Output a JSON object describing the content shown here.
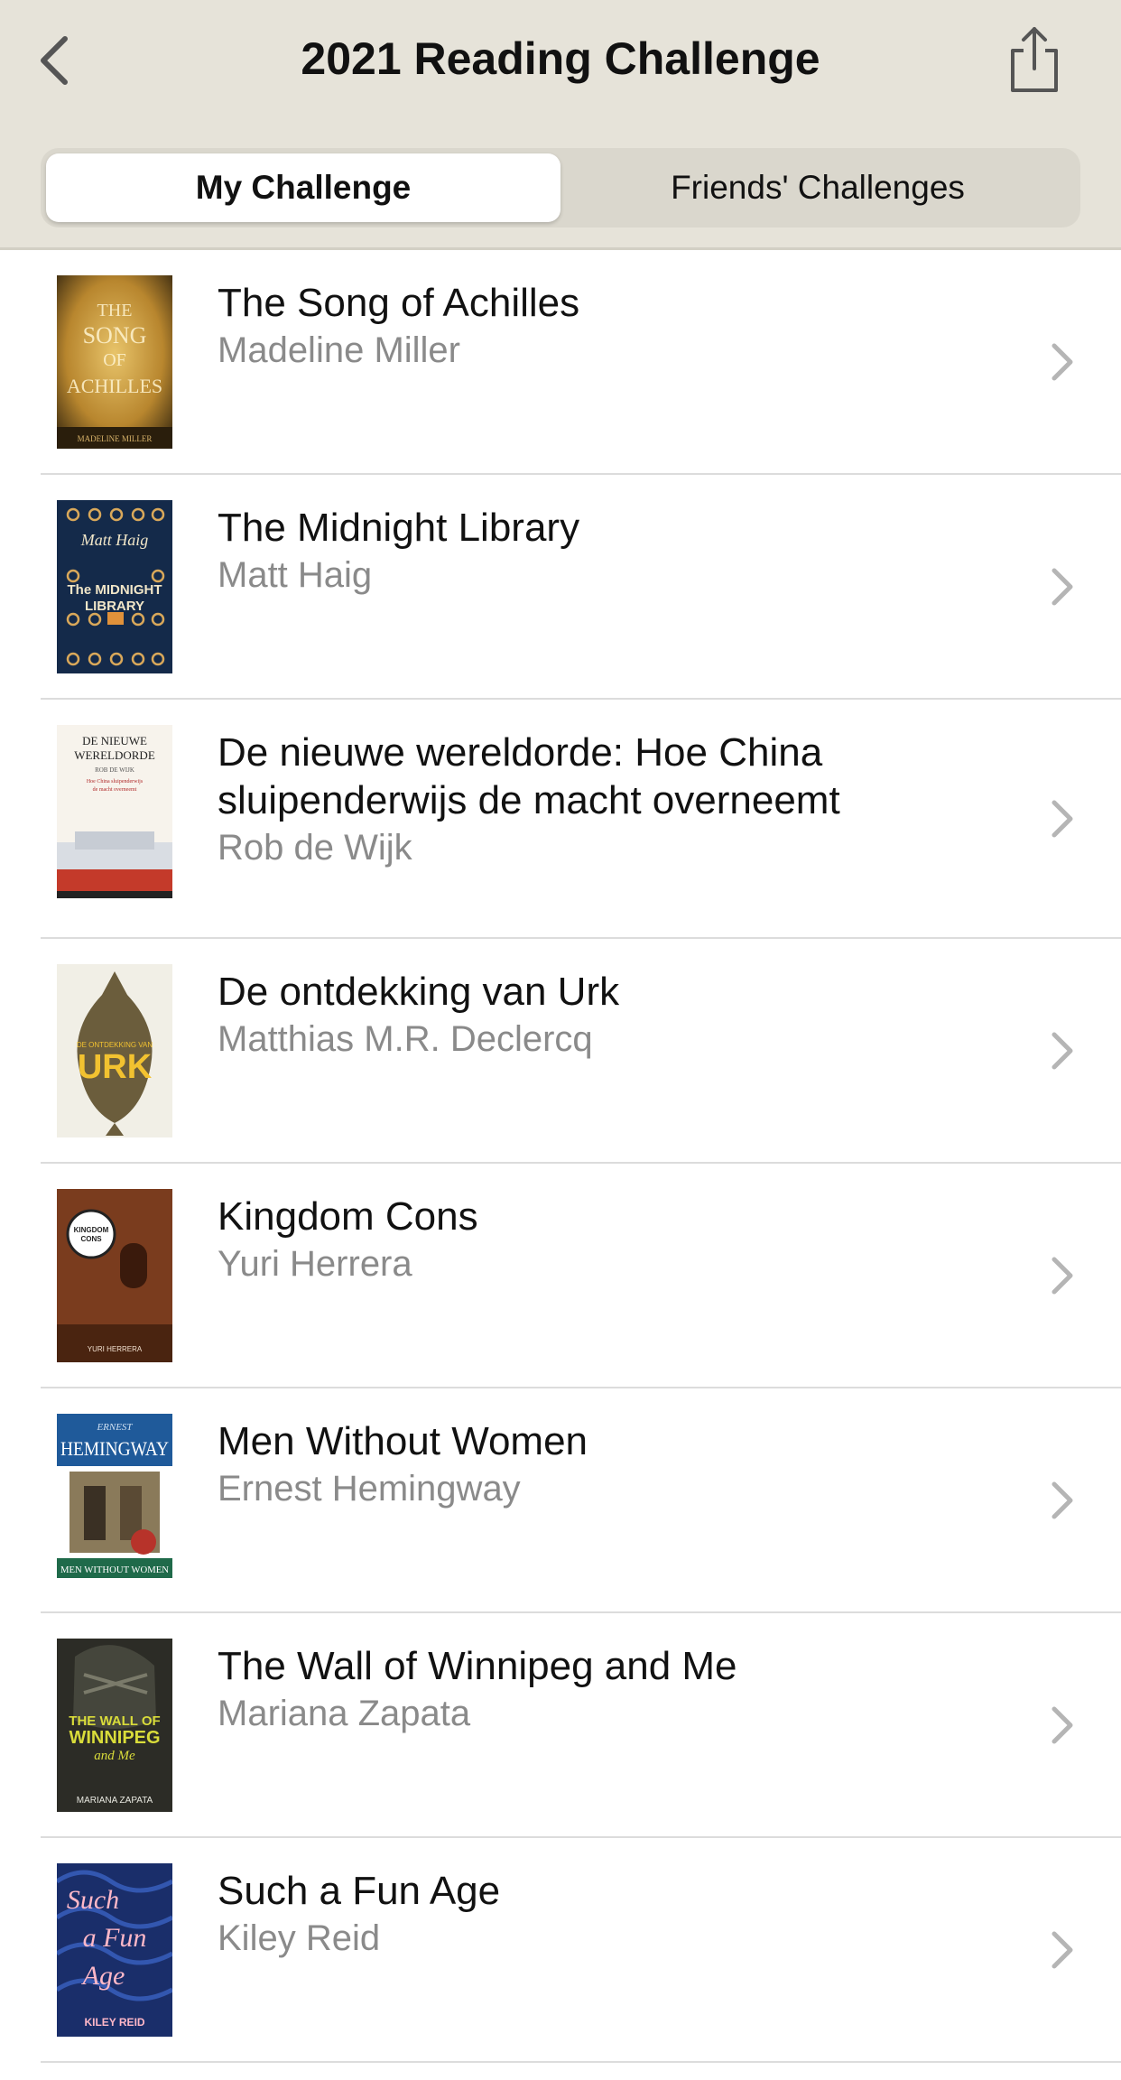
{
  "header": {
    "title": "2021 Reading Challenge",
    "back_icon": "chevron-left-icon",
    "share_icon": "share-icon"
  },
  "tabs": [
    {
      "label": "My Challenge",
      "selected": true
    },
    {
      "label": "Friends' Challenges",
      "selected": false
    }
  ],
  "books": [
    {
      "title": "The Song of Achilles",
      "author": "Madeline Miller",
      "cover": {
        "title_text": "THE SONG OF ACHILLES",
        "author_text": "MADELINE MILLER"
      }
    },
    {
      "title": "The Midnight Library",
      "author": "Matt Haig",
      "cover": {
        "title_text": "The MIDNIGHT LIBRARY",
        "author_text": "Matt Haig"
      }
    },
    {
      "title": "De nieuwe wereldorde: Hoe China sluipenderwijs de macht overneemt",
      "author": "Rob de Wijk",
      "cover": {
        "title_text": "DE NIEUWE WERELDORDE",
        "author_text": "ROB DE WIJK",
        "subtitle_text": "Hoe China sluipenderwijs de macht overneemt"
      }
    },
    {
      "title": "De ontdekking van Urk",
      "author": "Matthias M.R. Declercq",
      "cover": {
        "title_text": "URK",
        "small_text": "DE ONTDEKKING VAN"
      }
    },
    {
      "title": "Kingdom Cons",
      "author": "Yuri Herrera",
      "cover": {
        "title_text": "KINGDOM CONS",
        "author_text": "YURI HERRERA"
      }
    },
    {
      "title": "Men Without Women",
      "author": "Ernest Hemingway",
      "cover": {
        "title_text": "MEN WITHOUT WOMEN",
        "author_text": "HEMINGWAY",
        "small_text": "ERNEST"
      }
    },
    {
      "title": "The Wall of Winnipeg and Me",
      "author": "Mariana Zapata",
      "cover": {
        "title_text": "THE WALL OF WINNIPEG and Me",
        "author_text": "MARIANA ZAPATA"
      }
    },
    {
      "title": "Such a Fun Age",
      "author": "Kiley Reid",
      "cover": {
        "title_text": "Such a Fun Age",
        "author_text": "KILEY REID"
      }
    }
  ],
  "row_icon": "chevron-right-icon",
  "colors": {
    "header_bg": "#e6e3d9",
    "segment_bg": "#dad7cd",
    "author_gray": "#8a8a8a",
    "chevron_gray": "#b5b5b5"
  }
}
